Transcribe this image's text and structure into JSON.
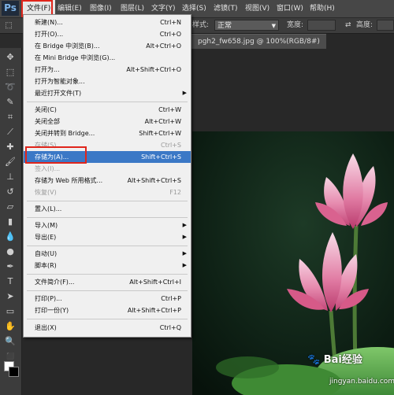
{
  "menubar": {
    "logo": "Ps",
    "items": [
      {
        "label": "文件(F)",
        "active": true
      },
      {
        "label": "编辑(E)"
      },
      {
        "label": "图像(I)"
      },
      {
        "label": "图层(L)"
      },
      {
        "label": "文字(Y)"
      },
      {
        "label": "选择(S)"
      },
      {
        "label": "滤镜(T)"
      },
      {
        "label": "视图(V)"
      },
      {
        "label": "窗口(W)"
      },
      {
        "label": "帮助(H)"
      }
    ]
  },
  "options_bar": {
    "style_label": "样式:",
    "style_value": "正常",
    "width_label": "宽度:",
    "height_label": "高度:"
  },
  "document": {
    "tab_title": "pgh2_fw658.jpg @ 100%(RGB/8#)"
  },
  "watermark": {
    "brand": "Bai",
    "brand2": "经验",
    "url": "jingyan.baidu.com"
  },
  "file_menu": {
    "items": [
      {
        "label": "新建(N)...",
        "shortcut": "Ctrl+N"
      },
      {
        "label": "打开(O)...",
        "shortcut": "Ctrl+O"
      },
      {
        "label": "在 Bridge 中浏览(B)...",
        "shortcut": "Alt+Ctrl+O"
      },
      {
        "label": "在 Mini Bridge 中浏览(G)...",
        "shortcut": ""
      },
      {
        "label": "打开为...",
        "shortcut": "Alt+Shift+Ctrl+O"
      },
      {
        "label": "打开为智能对象...",
        "shortcut": ""
      },
      {
        "label": "最近打开文件(T)",
        "shortcut": "",
        "submenu": true
      },
      {
        "label": "关闭(C)",
        "shortcut": "Ctrl+W"
      },
      {
        "label": "关闭全部",
        "shortcut": "Alt+Ctrl+W"
      },
      {
        "label": "关闭并转到 Bridge...",
        "shortcut": "Shift+Ctrl+W"
      },
      {
        "label": "存储(S)",
        "shortcut": "Ctrl+S",
        "disabled": true
      },
      {
        "label": "存储为(A)...",
        "shortcut": "Shift+Ctrl+S",
        "highlight": true
      },
      {
        "label": "签入(I)...",
        "shortcut": "",
        "disabled": true
      },
      {
        "label": "存储为 Web 所用格式...",
        "shortcut": "Alt+Shift+Ctrl+S"
      },
      {
        "label": "恢复(V)",
        "shortcut": "F12",
        "disabled": true
      },
      {
        "label": "置入(L)...",
        "shortcut": ""
      },
      {
        "label": "导入(M)",
        "shortcut": "",
        "submenu": true
      },
      {
        "label": "导出(E)",
        "shortcut": "",
        "submenu": true
      },
      {
        "label": "自动(U)",
        "shortcut": "",
        "submenu": true
      },
      {
        "label": "脚本(R)",
        "shortcut": "",
        "submenu": true
      },
      {
        "label": "文件简介(F)...",
        "shortcut": "Alt+Shift+Ctrl+I"
      },
      {
        "label": "打印(P)...",
        "shortcut": "Ctrl+P"
      },
      {
        "label": "打印一份(Y)",
        "shortcut": "Alt+Shift+Ctrl+P"
      },
      {
        "label": "退出(X)",
        "shortcut": "Ctrl+Q"
      }
    ]
  },
  "colors": {
    "highlight": "#3b78c6",
    "annotation_red": "#e0251b"
  }
}
